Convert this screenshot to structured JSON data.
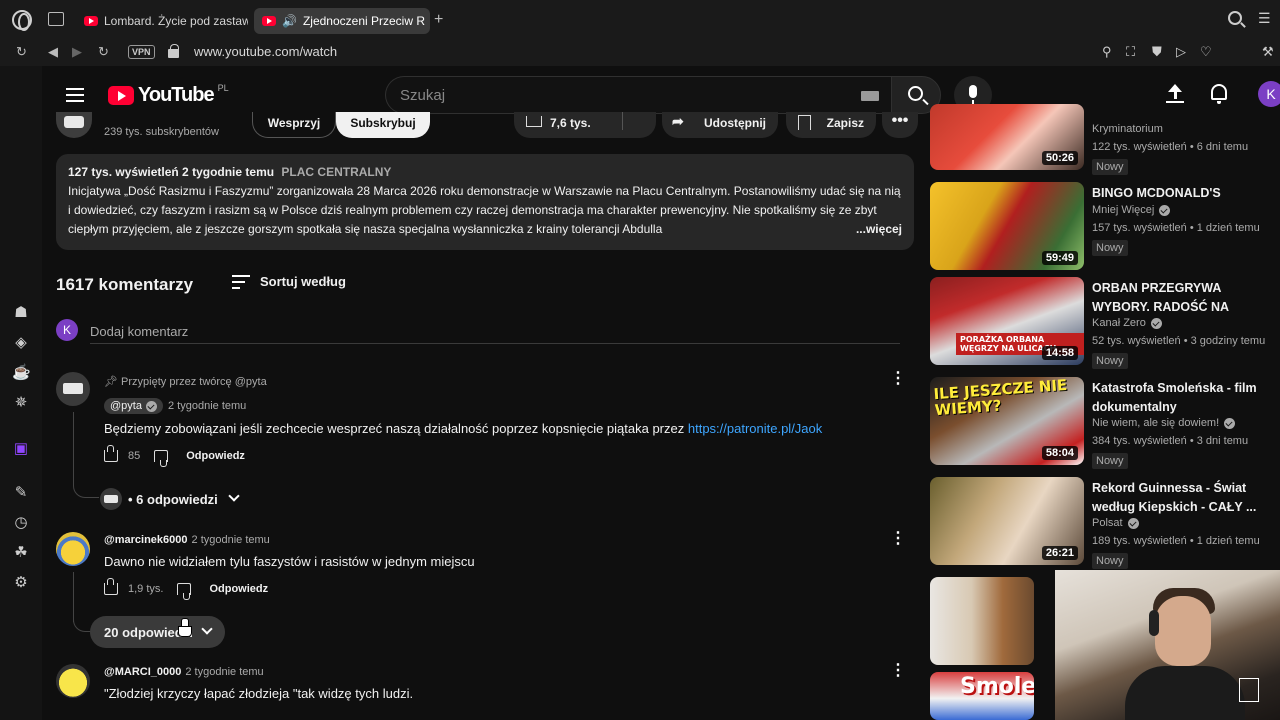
{
  "browser": {
    "tabs": [
      {
        "label": "Lombard. Życie pod zastaw"
      },
      {
        "label": "Zjednoczeni Przeciw R"
      }
    ],
    "vpn_label": "VPN",
    "url": "www.youtube.com/watch",
    "profile_initial": "K"
  },
  "youtube": {
    "logo_text": "YouTube",
    "country_code": "PL",
    "search_placeholder": "Szukaj",
    "avatar_initial": "K",
    "channel": {
      "subscribers": "239 tys. subskrybentów",
      "join_label": "Wesprzyj",
      "subscribe_label": "Subskrybuj",
      "like_count": "7,6 tys.",
      "share_label": "Udostępnij",
      "save_label": "Zapisz",
      "more_label": "•••"
    },
    "description": {
      "views_time": "127 tys. wyświetleń  2 tygodnie temu",
      "tag": "PLAC CENTRALNY",
      "text": "Inicjatywa „Dość Rasizmu i Faszyzmu” zorganizowała 28 Marca 2026 roku demonstracje w Warszawie na Placu Centralnym. Postanowiliśmy udać się na nią i dowiedzieć, czy faszyzm i rasizm są w Polsce dziś realnym problemem czy raczej demonstracja ma charakter prewencyjny. Nie spotkaliśmy się ze zbyt ciepłym przyjęciem, ale z jeszcze gorszym spotkała się nasza specjalna wysłanniczka z krainy tolerancji Abdulla",
      "more_label": "...więcej"
    },
    "comments": {
      "count_label": "1617 komentarzy",
      "sort_label": "Sortuj według",
      "add_placeholder": "Dodaj komentarz",
      "add_avatar_initial": "K",
      "items": [
        {
          "pinned_label": "Przypięty przez twórcę @pyta",
          "author": "@pyta",
          "time": "2 tygodnie temu",
          "text_before_link": "Będziemy zobowiązani jeśli zechcecie wesprzeć naszą działalność poprzez kopsnięcie piątaka przez ",
          "link": "https://patronite.pl/Jaok",
          "likes": "85",
          "reply_label": "Odpowiedz",
          "replies_label": "• 6 odpowiedzi"
        },
        {
          "author": "@marcinek6000",
          "time": "2 tygodnie temu",
          "text": "Dawno nie widziałem tylu faszystów i rasistów w jednym miejscu",
          "likes": "1,9 tys.",
          "reply_label": "Odpowiedz",
          "replies_label": "20 odpowiedzi"
        },
        {
          "author": "@MARCI_0000",
          "time": "2 tygodnie temu",
          "text": "\"Złodziej krzyczy łapać złodzieja \"tak widzę tych ludzi."
        }
      ]
    },
    "recommendations": [
      {
        "title": "",
        "channel": "Kryminatorium",
        "verified": false,
        "meta": "122 tys. wyświetleń • 6 dni temu",
        "badge": "Nowy",
        "duration": "50:26"
      },
      {
        "title": "BINGO MCDONALD'S",
        "channel": "Mniej Więcej",
        "verified": true,
        "meta": "157 tys. wyświetleń • 1 dzień temu",
        "badge": "Nowy",
        "duration": "59:49"
      },
      {
        "title": "ORBAN PRZEGRYWA WYBORY. RADOŚĆ NA WĘGRZECH. ...",
        "channel": "Kanał Zero",
        "verified": true,
        "meta": "52 tys. wyświetleń • 3 godziny temu",
        "badge": "Nowy",
        "duration": "14:58",
        "thumb_text": "PORAŻKA ORBANA WĘGRZY NA ULICACH"
      },
      {
        "title": "Katastrofa Smoleńska - film dokumentalny",
        "channel": "Nie wiem, ale się dowiem!",
        "verified": true,
        "meta": "384 tys. wyświetleń • 3 dni temu",
        "badge": "Nowy",
        "duration": "58:04",
        "thumb_text": "ILE JESZCZE NIE WIEMY?"
      },
      {
        "title": "Rekord Guinnessa - Świat według Kiepskich - CAŁY ...",
        "channel": "Polsat",
        "verified": true,
        "meta": "189 tys. wyświetleń • 1 dzień temu",
        "badge": "Nowy",
        "duration": "26:21"
      },
      {
        "title": "",
        "channel": "",
        "meta": "",
        "badge": "",
        "duration": ""
      },
      {
        "title": "",
        "thumb_text": "Smole"
      }
    ]
  }
}
